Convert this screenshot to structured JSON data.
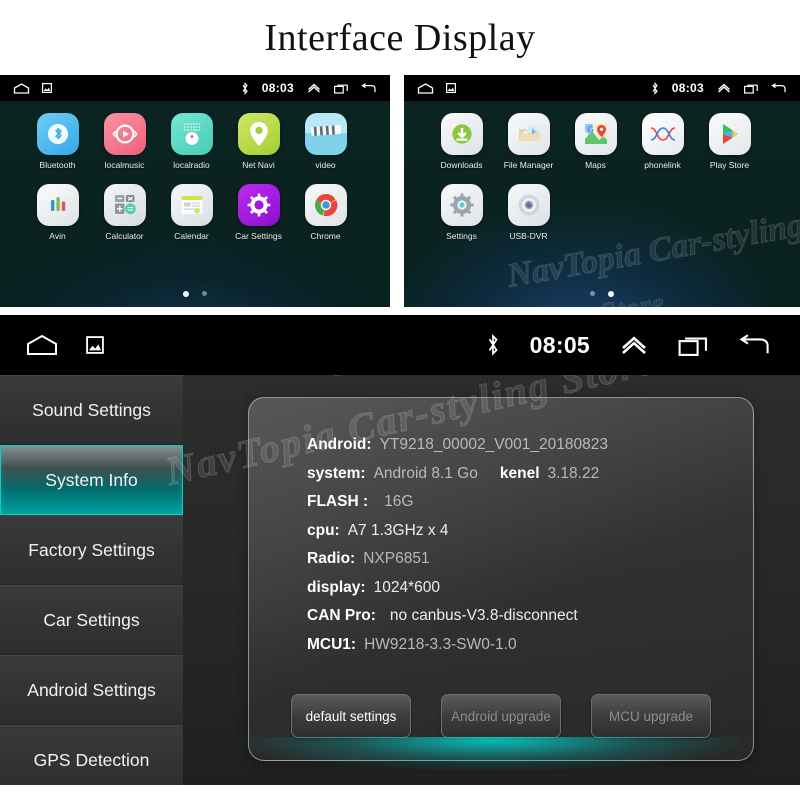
{
  "page": {
    "title": "Interface Display"
  },
  "watermark": {
    "text": "NavTopia Car-styling Store"
  },
  "screen1": {
    "status": {
      "time": "08:03",
      "home_icon": "home-icon",
      "screenshot_icon": "screenshot-icon",
      "bluetooth_icon": "bluetooth-icon",
      "chevron_up_icon": "chevron-up-icon",
      "recents_icon": "recents-icon",
      "back_icon": "back-icon"
    },
    "apps_row1": [
      {
        "label": "Bluetooth",
        "icon": "bluetooth-app-icon",
        "color": "#4ab8ef"
      },
      {
        "label": "localmusic",
        "icon": "music-app-icon",
        "color": "#f4798c"
      },
      {
        "label": "localradio",
        "icon": "radio-app-icon",
        "color": "#5fd9c7"
      },
      {
        "label": "Net Navi",
        "icon": "navigation-app-icon",
        "color": "#b9d94b"
      },
      {
        "label": "video",
        "icon": "video-app-icon",
        "color": "#8fd9ee"
      }
    ],
    "apps_row2": [
      {
        "label": "Avin",
        "icon": "avin-app-icon",
        "color": "#e8eaec"
      },
      {
        "label": "Calculator",
        "icon": "calculator-app-icon",
        "color": "#dfe2e5"
      },
      {
        "label": "Calendar",
        "icon": "calendar-app-icon",
        "color": "#e4e7ea"
      },
      {
        "label": "Car Settings",
        "icon": "car-settings-app-icon",
        "color": "#a515e0"
      },
      {
        "label": "Chrome",
        "icon": "chrome-app-icon",
        "color": "#eceef0"
      }
    ],
    "pager": {
      "count": 2,
      "active": 0
    }
  },
  "screen2": {
    "status": {
      "time": "08:03"
    },
    "apps_row1": [
      {
        "label": "Downloads",
        "icon": "downloads-app-icon",
        "color": "#e9ecee"
      },
      {
        "label": "File Manager",
        "icon": "file-manager-app-icon",
        "color": "#eceff1"
      },
      {
        "label": "Maps",
        "icon": "maps-app-icon",
        "color": "#f1f3f4"
      },
      {
        "label": "phonelink",
        "icon": "phonelink-app-icon",
        "color": "#f4f6f7"
      },
      {
        "label": "Play Store",
        "icon": "play-store-app-icon",
        "color": "#f2f4f5"
      }
    ],
    "apps_row2": [
      {
        "label": "Settings",
        "icon": "settings-app-icon",
        "color": "#e7eaec"
      },
      {
        "label": "USB-DVR",
        "icon": "usb-dvr-app-icon",
        "color": "#e9ecef"
      }
    ],
    "pager": {
      "count": 2,
      "active": 1
    }
  },
  "main": {
    "status": {
      "time": "08:05"
    },
    "sidebar": {
      "items": [
        {
          "label": "Sound Settings",
          "active": false
        },
        {
          "label": "System Info",
          "active": true
        },
        {
          "label": "Factory Settings",
          "active": false
        },
        {
          "label": "Car Settings",
          "active": false
        },
        {
          "label": "Android Settings",
          "active": false
        },
        {
          "label": "GPS Detection",
          "active": false
        }
      ]
    },
    "info": {
      "android_label": "Android:",
      "android_value": "YT9218_00002_V001_20180823",
      "system_label": "system:",
      "system_value": "Android 8.1 Go",
      "kernel_label": "kenel",
      "kernel_value": "3.18.22",
      "flash_label": "FLASH :",
      "flash_value": "16G",
      "cpu_label": "cpu:",
      "cpu_value": "A7 1.3GHz x 4",
      "radio_label": "Radio:",
      "radio_value": "NXP6851",
      "display_label": "display:",
      "display_value": "1024*600",
      "can_label": "CAN Pro:",
      "can_value": "no canbus-V3.8-disconnect",
      "mcu_label": "MCU1:",
      "mcu_value": "HW9218-3.3-SW0-1.0"
    },
    "buttons": {
      "default_settings": "default settings",
      "android_upgrade": "Android upgrade",
      "mcu_upgrade": "MCU upgrade"
    },
    "accent_color": "#00a3a0"
  }
}
